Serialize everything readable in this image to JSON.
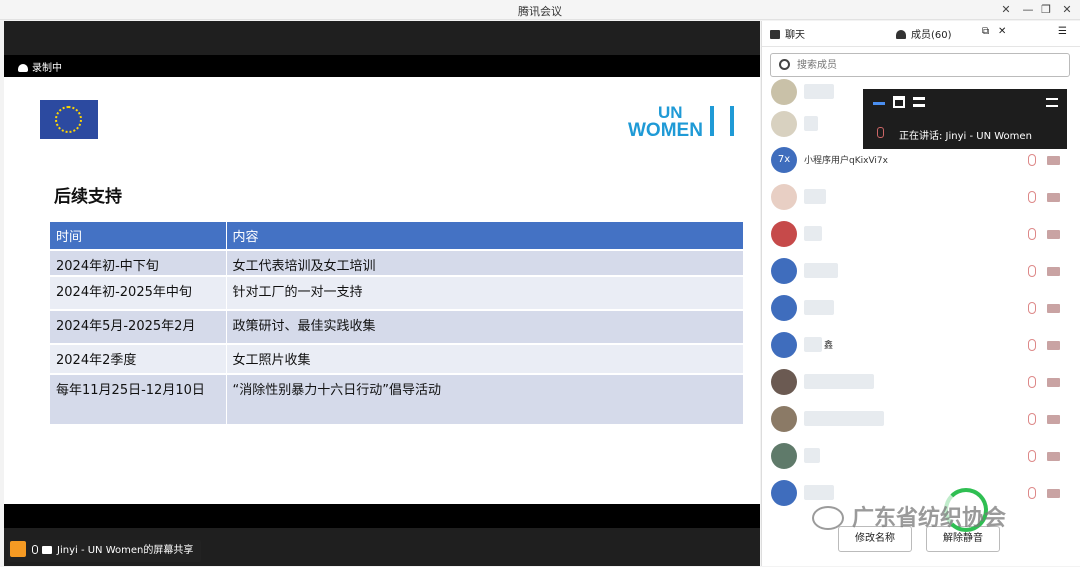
{
  "window": {
    "title": "腾讯会议"
  },
  "recording": {
    "label": "录制中"
  },
  "slide": {
    "heading": "后续支持",
    "logo_text_line1": "UN",
    "logo_text_line2": "WOMEN",
    "table": {
      "headers": [
        "时间",
        "内容"
      ],
      "rows": [
        [
          "2024年初-中下旬",
          "女工代表培训及女工培训"
        ],
        [
          "2024年初-2025年中旬",
          "针对工厂的一对一支持"
        ],
        [
          "2024年5月-2025年2月",
          "政策研讨、最佳实践收集"
        ],
        [
          "2024年2季度",
          "女工照片收集"
        ],
        [
          "每年11月25日-12月10日",
          "“消除性别暴力十六日行动”倡导活动"
        ]
      ]
    }
  },
  "share_label": "Jinyi - UN Women的屏幕共享",
  "panel": {
    "tab_chat": "聊天",
    "tab_members": "成员(60)",
    "search_placeholder": "搜索成员",
    "members": [
      {
        "name": "",
        "avatar": ""
      },
      {
        "name": "",
        "avatar": ""
      },
      {
        "name": "小程序用户qKixVi7x",
        "avatar": "7x"
      },
      {
        "name": "",
        "avatar": ""
      },
      {
        "name": "",
        "avatar": ""
      },
      {
        "name": "",
        "avatar": ""
      },
      {
        "name": "",
        "avatar": ""
      },
      {
        "name": "鑫",
        "avatar": ""
      },
      {
        "name": "",
        "avatar": ""
      },
      {
        "name": "",
        "avatar": ""
      },
      {
        "name": "",
        "avatar": ""
      },
      {
        "name": "",
        "avatar": ""
      }
    ],
    "speaking": "正在讲话:  Jinyi - UN Women",
    "btn_rename": "修改名称",
    "btn_unmute": "解除静音"
  },
  "watermark": "广东省纺织协会",
  "colors": {
    "table_header": "#4472c4",
    "accent_blue": "#1f9ad6",
    "panel_bg": "#ffffff"
  }
}
